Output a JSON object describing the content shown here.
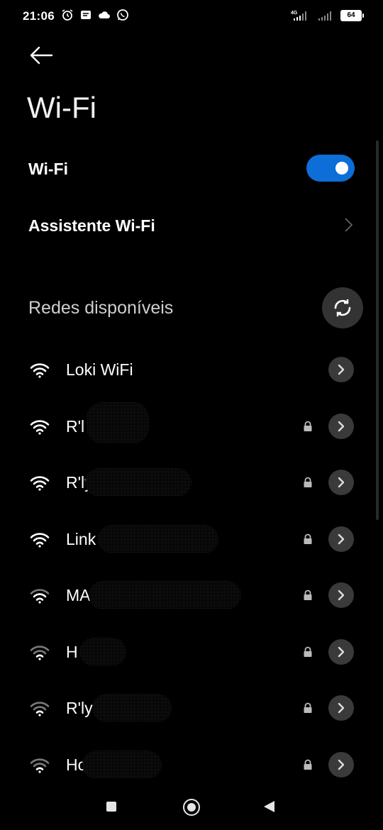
{
  "status_bar": {
    "time": "21:06",
    "network_type": "4G",
    "battery": "64",
    "left_icons": [
      "alarm-icon",
      "message-icon",
      "cloud-icon",
      "whatsapp-icon"
    ]
  },
  "header": {
    "title": "Wi-Fi"
  },
  "wifi_toggle": {
    "label": "Wi-Fi",
    "on": true,
    "color": "#0d6ed8"
  },
  "assistant": {
    "label": "Assistente Wi-Fi"
  },
  "section": {
    "title": "Redes disponíveis"
  },
  "networks": [
    {
      "name": "Loki WiFi",
      "locked": false,
      "signal": "strong"
    },
    {
      "name": "R'l",
      "locked": true,
      "signal": "strong"
    },
    {
      "name": "R'ly",
      "locked": true,
      "signal": "strong"
    },
    {
      "name": "Link",
      "locked": true,
      "signal": "strong"
    },
    {
      "name": "MA",
      "locked": true,
      "signal": "medium"
    },
    {
      "name": "H",
      "locked": true,
      "signal": "weak"
    },
    {
      "name": "R'ly",
      "locked": true,
      "signal": "weak"
    },
    {
      "name": "Ho",
      "locked": true,
      "signal": "weak"
    }
  ]
}
